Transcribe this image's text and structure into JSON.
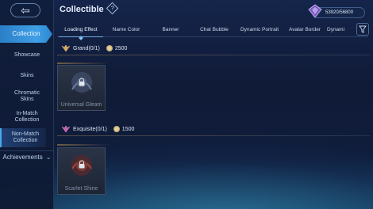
{
  "header": {
    "title": "Collectible",
    "help_symbol": "?"
  },
  "currency": {
    "value": "53920/56800",
    "icon": "diamond-gem-icon"
  },
  "back_symbol": "⇦",
  "sidebar": {
    "items": [
      {
        "label": "Collection",
        "active": true
      },
      {
        "label": "Showcase"
      },
      {
        "label": "Skins"
      },
      {
        "label": "Chromatic Skins"
      },
      {
        "label": "In-Match Collection"
      },
      {
        "label": "Non-Match Collection",
        "selected": true
      }
    ],
    "achievements": "Achievements"
  },
  "tabs": [
    {
      "label": "Loading Effect",
      "active": true
    },
    {
      "label": "Name Color"
    },
    {
      "label": "Banner"
    },
    {
      "label": "Chat Bubble"
    },
    {
      "label": "Dynamic Portrait"
    },
    {
      "label": "Avatar Border"
    },
    {
      "label": "Dynami"
    }
  ],
  "sections": [
    {
      "grade": "Grand(0/1)",
      "cost": "2500",
      "items": [
        {
          "name": "Universal Gleam",
          "locked": true
        }
      ]
    },
    {
      "grade": "Exquisite(0/1)",
      "cost": "1500",
      "items": [
        {
          "name": "Scarlet Shine",
          "locked": true
        }
      ]
    }
  ],
  "colors": {
    "accent": "#3fa0e6",
    "grand": "#d9a55a",
    "exquisite": "#c25fa8"
  }
}
